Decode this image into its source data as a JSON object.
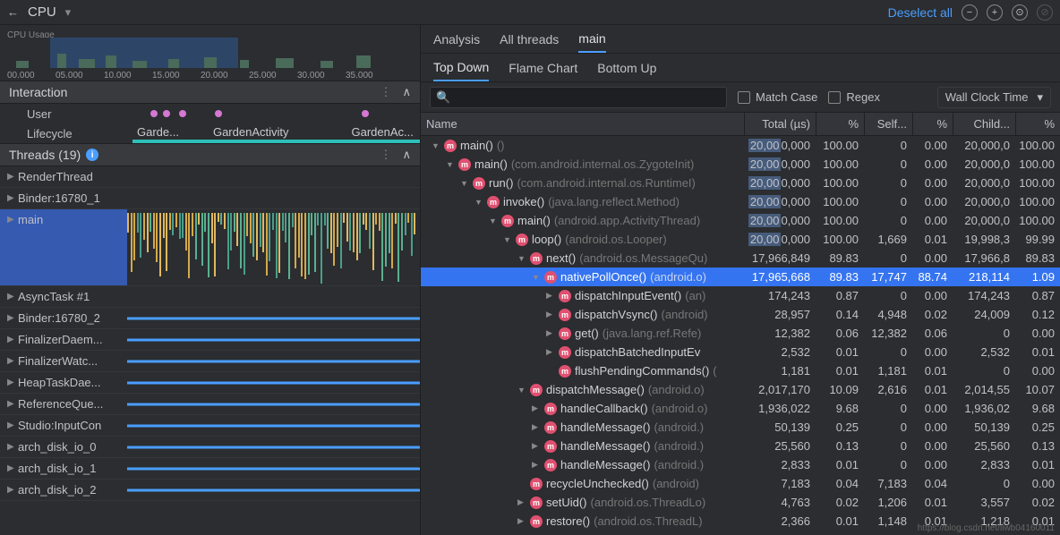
{
  "top": {
    "back": "←",
    "cpu_label": "CPU",
    "deselect": "Deselect all"
  },
  "usage": {
    "label": "CPU Usage",
    "ticks": [
      "00.000",
      "05.000",
      "10.000",
      "15.000",
      "20.000",
      "25.000",
      "30.000",
      "35.000"
    ]
  },
  "interaction": {
    "title": "Interaction",
    "user_label": "User",
    "lifecycle_label": "Lifecycle",
    "lifecycle_entries": [
      "Garde...",
      "GardenActivity",
      "GardenAc..."
    ]
  },
  "threads": {
    "title": "Threads (19)",
    "items": [
      {
        "name": "RenderThread",
        "tall": false
      },
      {
        "name": "Binder:16780_1",
        "tall": false
      },
      {
        "name": "main",
        "tall": true,
        "selected": true
      },
      {
        "name": "AsyncTask #1",
        "tall": false
      },
      {
        "name": "Binder:16780_2",
        "tall": false
      },
      {
        "name": "FinalizerDaem...",
        "tall": false
      },
      {
        "name": "FinalizerWatc...",
        "tall": false
      },
      {
        "name": "HeapTaskDae...",
        "tall": false
      },
      {
        "name": "ReferenceQue...",
        "tall": false
      },
      {
        "name": "Studio:InputCon",
        "tall": false
      },
      {
        "name": "arch_disk_io_0",
        "tall": false
      },
      {
        "name": "arch_disk_io_1",
        "tall": false
      },
      {
        "name": "arch_disk_io_2",
        "tall": false
      }
    ]
  },
  "tabs": {
    "analysis": "Analysis",
    "all_threads": "All threads",
    "main": "main",
    "top_down": "Top Down",
    "flame_chart": "Flame Chart",
    "bottom_up": "Bottom Up"
  },
  "filter": {
    "search_placeholder": "",
    "match_case": "Match Case",
    "regex": "Regex",
    "time_mode": "Wall Clock Time"
  },
  "headers": {
    "name": "Name",
    "total": "Total (µs)",
    "total_pct": "%",
    "self": "Self...",
    "self_pct": "%",
    "children": "Child...",
    "children_pct": "%"
  },
  "tree": [
    {
      "indent": 0,
      "caret": "▼",
      "name": "main()",
      "pkg": "()",
      "total": "20,000,000",
      "totalp": "100.00",
      "self": "0",
      "selfp": "0.00",
      "child": "20,000,0",
      "childp": "100.00",
      "hl": true
    },
    {
      "indent": 1,
      "caret": "▼",
      "name": "main()",
      "pkg": "(com.android.internal.os.ZygoteInit)",
      "total": "20,000,000",
      "totalp": "100.00",
      "self": "0",
      "selfp": "0.00",
      "child": "20,000,0",
      "childp": "100.00",
      "hl": true
    },
    {
      "indent": 2,
      "caret": "▼",
      "name": "run()",
      "pkg": "(com.android.internal.os.RuntimeI)",
      "total": "20,000,000",
      "totalp": "100.00",
      "self": "0",
      "selfp": "0.00",
      "child": "20,000,0",
      "childp": "100.00",
      "hl": true
    },
    {
      "indent": 3,
      "caret": "▼",
      "name": "invoke()",
      "pkg": "(java.lang.reflect.Method)",
      "total": "20,000,000",
      "totalp": "100.00",
      "self": "0",
      "selfp": "0.00",
      "child": "20,000,0",
      "childp": "100.00",
      "hl": true
    },
    {
      "indent": 4,
      "caret": "▼",
      "name": "main()",
      "pkg": "(android.app.ActivityThread)",
      "total": "20,000,000",
      "totalp": "100.00",
      "self": "0",
      "selfp": "0.00",
      "child": "20,000,0",
      "childp": "100.00",
      "hl": true
    },
    {
      "indent": 5,
      "caret": "▼",
      "name": "loop()",
      "pkg": "(android.os.Looper)",
      "total": "20,000,000",
      "totalp": "100.00",
      "self": "1,669",
      "selfp": "0.01",
      "child": "19,998,3",
      "childp": "99.99",
      "hl": true
    },
    {
      "indent": 6,
      "caret": "▼",
      "name": "next()",
      "pkg": "(android.os.MessageQu)",
      "total": "17,966,849",
      "totalp": "89.83",
      "self": "0",
      "selfp": "0.00",
      "child": "17,966,8",
      "childp": "89.83",
      "hl": true
    },
    {
      "indent": 7,
      "caret": "▼",
      "name": "nativePollOnce()",
      "pkg": "(android.o)",
      "total": "17,965,668",
      "totalp": "89.83",
      "self": "17,747",
      "selfp": "88.74",
      "child": "218,114",
      "childp": "1.09",
      "hl": true,
      "selected": true
    },
    {
      "indent": 8,
      "caret": "▶",
      "name": "dispatchInputEvent()",
      "pkg": "(an)",
      "total": "174,243",
      "totalp": "0.87",
      "self": "0",
      "selfp": "0.00",
      "child": "174,243",
      "childp": "0.87"
    },
    {
      "indent": 8,
      "caret": "▶",
      "name": "dispatchVsync()",
      "pkg": "(android)",
      "total": "28,957",
      "totalp": "0.14",
      "self": "4,948",
      "selfp": "0.02",
      "child": "24,009",
      "childp": "0.12"
    },
    {
      "indent": 8,
      "caret": "▶",
      "name": "get()",
      "pkg": "(java.lang.ref.Refe)",
      "total": "12,382",
      "totalp": "0.06",
      "self": "12,382",
      "selfp": "0.06",
      "child": "0",
      "childp": "0.00"
    },
    {
      "indent": 8,
      "caret": "▶",
      "name": "dispatchBatchedInputEv",
      "pkg": "",
      "total": "2,532",
      "totalp": "0.01",
      "self": "0",
      "selfp": "0.00",
      "child": "2,532",
      "childp": "0.01"
    },
    {
      "indent": 8,
      "caret": "",
      "name": "flushPendingCommands()",
      "pkg": "(",
      "total": "1,181",
      "totalp": "0.01",
      "self": "1,181",
      "selfp": "0.01",
      "child": "0",
      "childp": "0.00"
    },
    {
      "indent": 6,
      "caret": "▼",
      "name": "dispatchMessage()",
      "pkg": "(android.o)",
      "total": "2,017,170",
      "totalp": "10.09",
      "self": "2,616",
      "selfp": "0.01",
      "child": "2,014,55",
      "childp": "10.07"
    },
    {
      "indent": 7,
      "caret": "▶",
      "name": "handleCallback()",
      "pkg": "(android.o)",
      "total": "1,936,022",
      "totalp": "9.68",
      "self": "0",
      "selfp": "0.00",
      "child": "1,936,02",
      "childp": "9.68"
    },
    {
      "indent": 7,
      "caret": "▶",
      "name": "handleMessage()",
      "pkg": "(android.)",
      "total": "50,139",
      "totalp": "0.25",
      "self": "0",
      "selfp": "0.00",
      "child": "50,139",
      "childp": "0.25"
    },
    {
      "indent": 7,
      "caret": "▶",
      "name": "handleMessage()",
      "pkg": "(android.)",
      "total": "25,560",
      "totalp": "0.13",
      "self": "0",
      "selfp": "0.00",
      "child": "25,560",
      "childp": "0.13"
    },
    {
      "indent": 7,
      "caret": "▶",
      "name": "handleMessage()",
      "pkg": "(android.)",
      "total": "2,833",
      "totalp": "0.01",
      "self": "0",
      "selfp": "0.00",
      "child": "2,833",
      "childp": "0.01"
    },
    {
      "indent": 6,
      "caret": "",
      "name": "recycleUnchecked()",
      "pkg": "(android)",
      "total": "7,183",
      "totalp": "0.04",
      "self": "7,183",
      "selfp": "0.04",
      "child": "0",
      "childp": "0.00"
    },
    {
      "indent": 6,
      "caret": "▶",
      "name": "setUid()",
      "pkg": "(android.os.ThreadLo)",
      "total": "4,763",
      "totalp": "0.02",
      "self": "1,206",
      "selfp": "0.01",
      "child": "3,557",
      "childp": "0.02"
    },
    {
      "indent": 6,
      "caret": "▶",
      "name": "restore()",
      "pkg": "(android.os.ThreadL)",
      "total": "2,366",
      "totalp": "0.01",
      "self": "1,148",
      "selfp": "0.01",
      "child": "1,218",
      "childp": "0.01"
    }
  ],
  "footer": "https://blog.csdn.net/liwb04160011"
}
